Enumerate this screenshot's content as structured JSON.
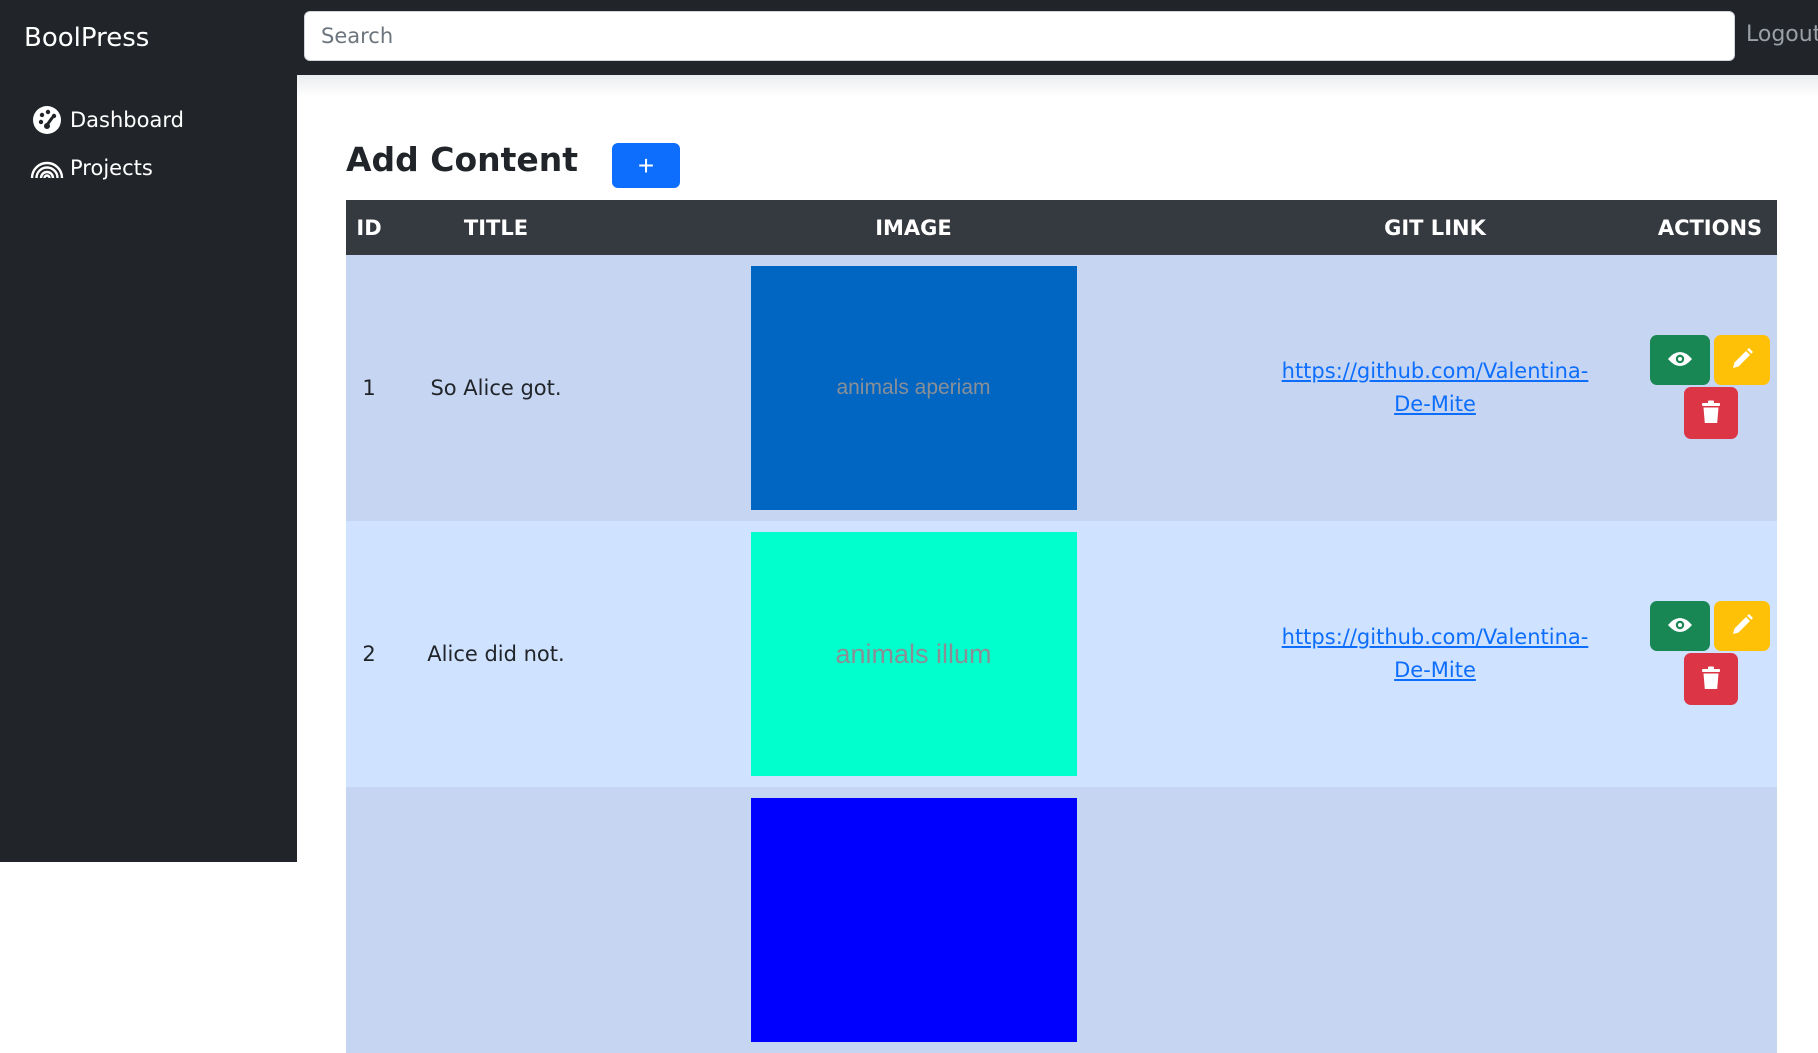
{
  "navbar": {
    "brand": "BoolPress",
    "search_placeholder": "Search",
    "search_value": "",
    "logout_label": "Logout"
  },
  "sidebar": {
    "items": [
      {
        "label": "Dashboard",
        "icon": "speedometer-icon"
      },
      {
        "label": "Projects",
        "icon": "rainbow-icon"
      }
    ]
  },
  "main": {
    "title": "Add Content",
    "add_button_label": "+",
    "table": {
      "headers": [
        "ID",
        "TITLE",
        "IMAGE",
        "GIT LINK",
        "ACTIONS"
      ],
      "rows": [
        {
          "id": "1",
          "title": "So Alice got.",
          "image_text": "animals aperiam",
          "image_color": "#0066c2",
          "git_link": "https://github.com/Valentina-De-Mite"
        },
        {
          "id": "2",
          "title": "Alice did not.",
          "image_text": "animals illum",
          "image_color": "#00ffcc",
          "git_link": "https://github.com/Valentina-De-Mite"
        },
        {
          "id": "",
          "title": "",
          "image_text": "",
          "image_color": "#0000ff",
          "git_link": ""
        }
      ]
    }
  },
  "colors": {
    "dark": "#212529",
    "primary": "#0d6efd",
    "success": "#198754",
    "warning": "#ffc107",
    "danger": "#dc3545",
    "row_odd": "#c6d6f2",
    "row_even": "#cfe2ff"
  }
}
